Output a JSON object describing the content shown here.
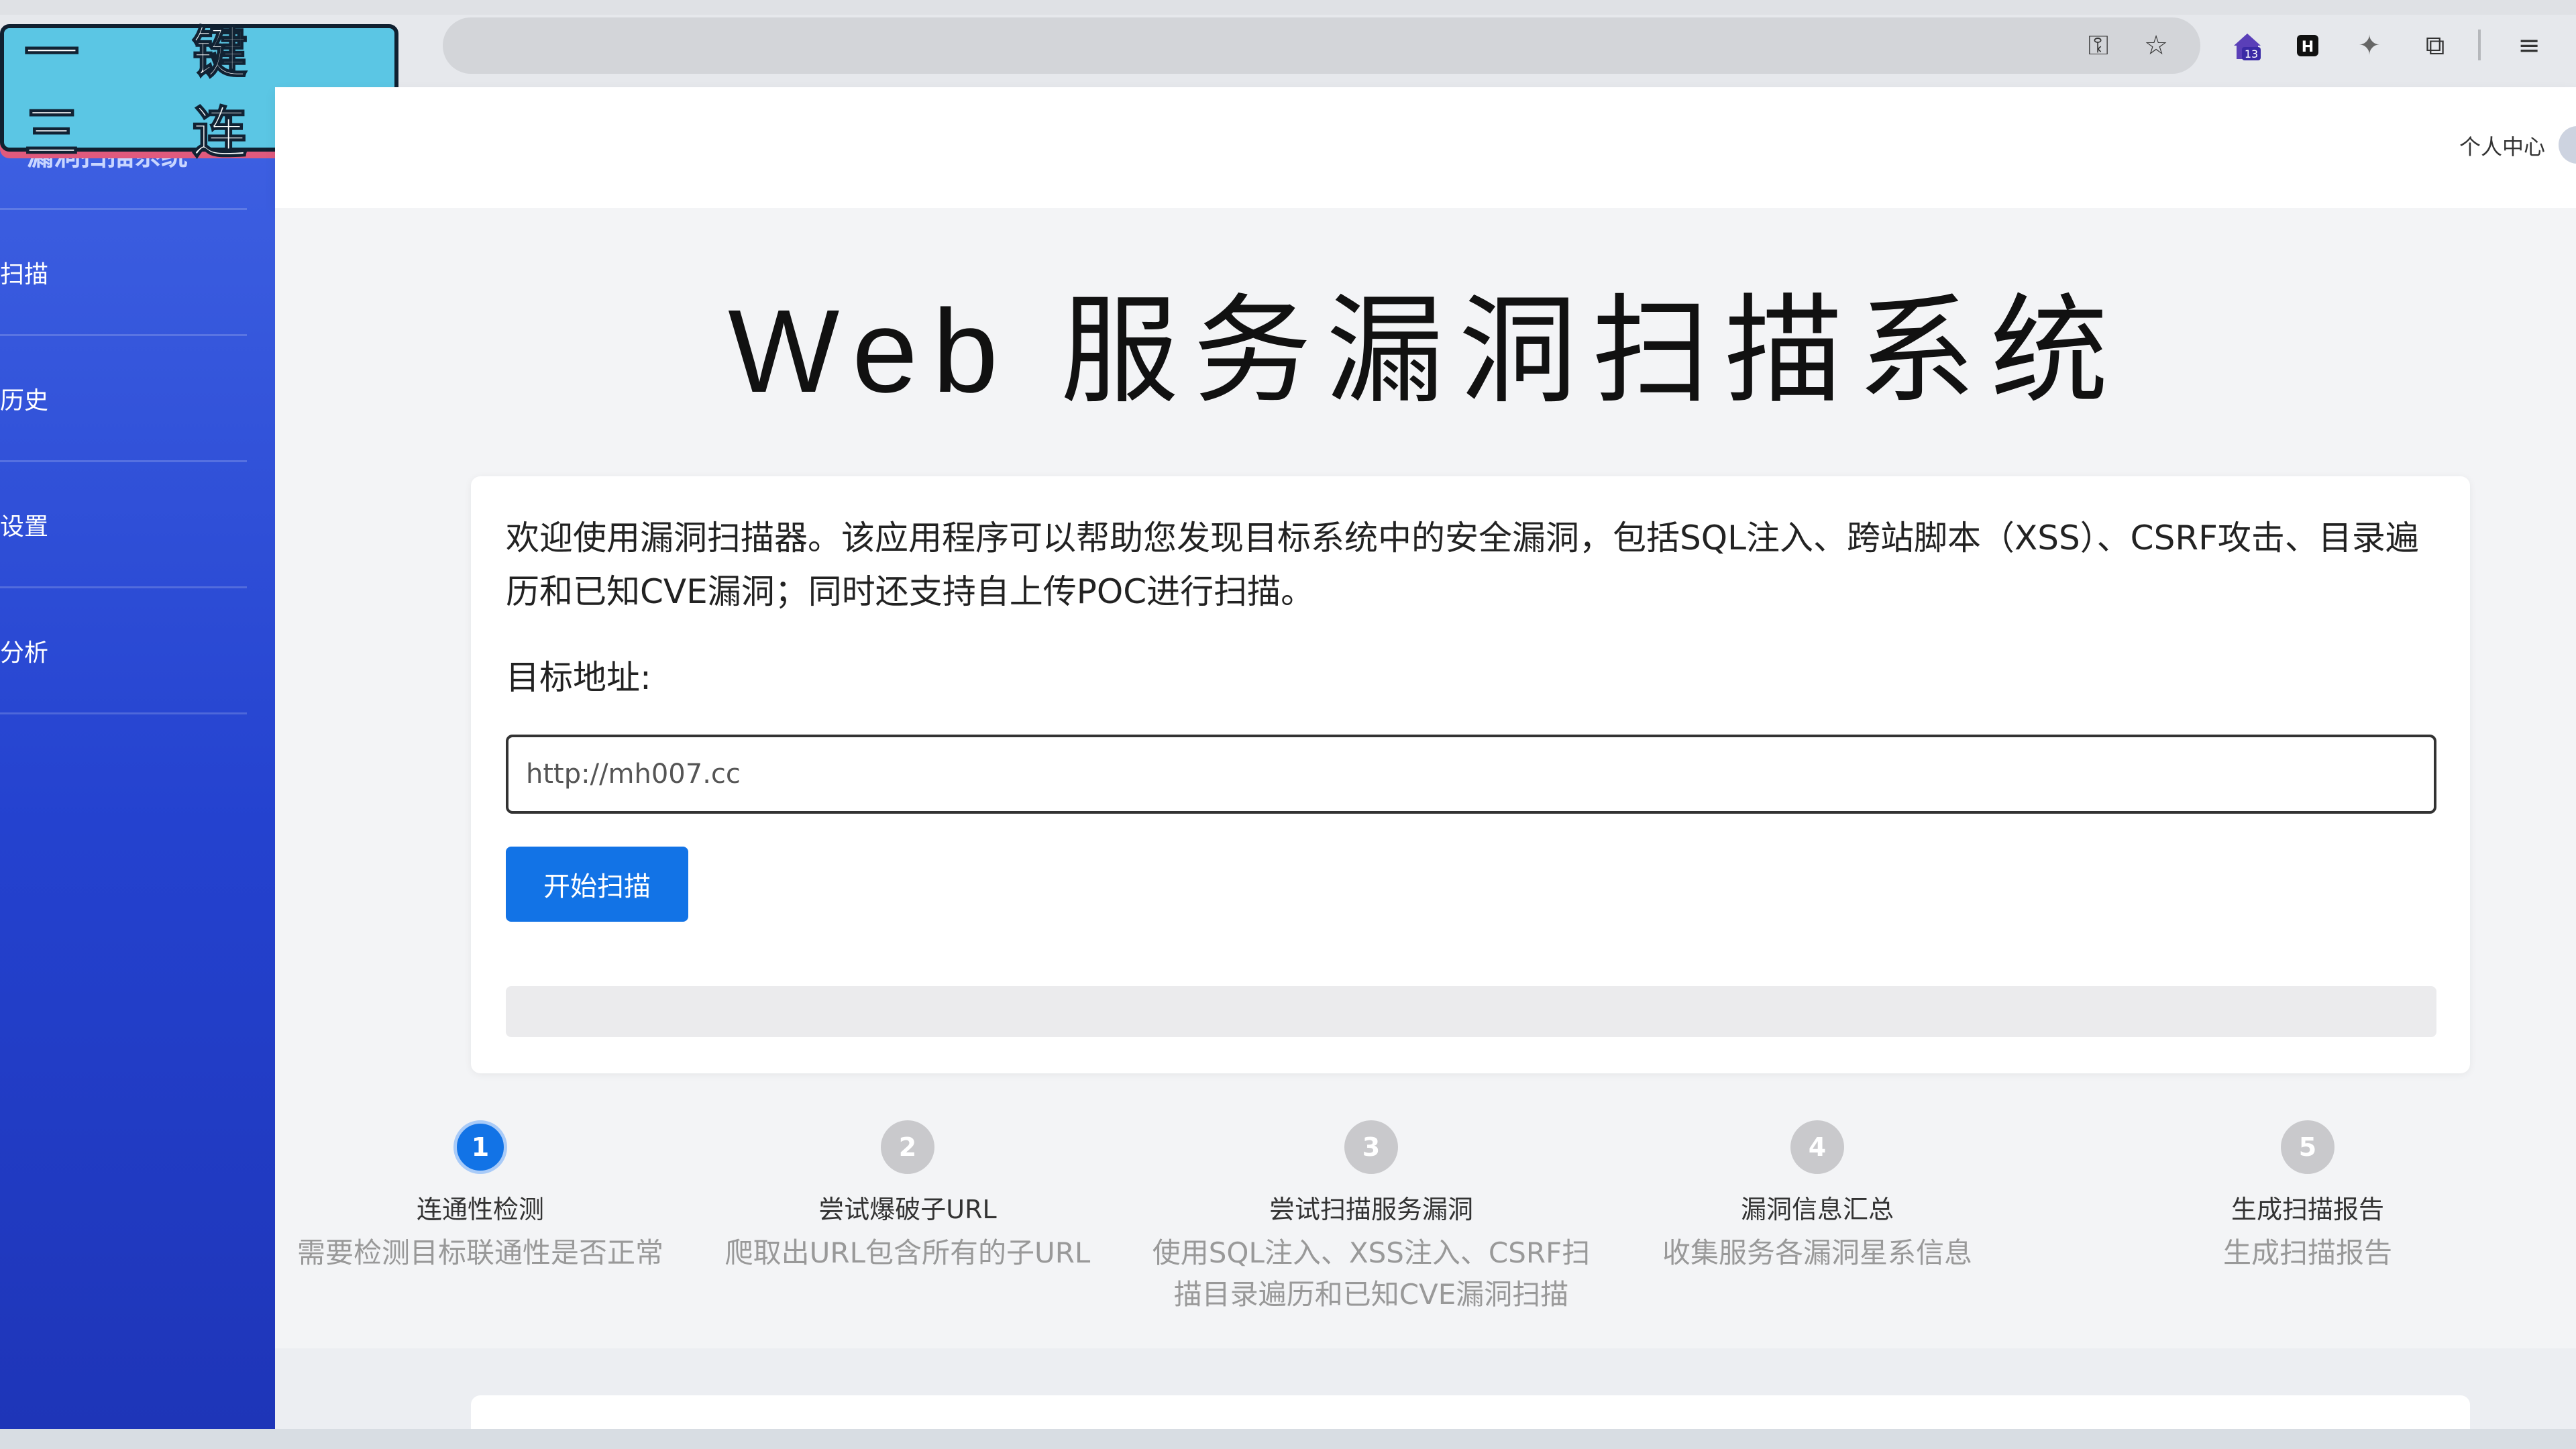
{
  "overlay": {
    "badge_text": "一 键 三 连",
    "star": "★"
  },
  "browser": {
    "icons": [
      "key-icon",
      "star-icon",
      "extension-badge-icon",
      "extension-icon",
      "puzzle-icon",
      "extensions-icon",
      "reading-list-icon"
    ],
    "extension_badge_count": "13"
  },
  "sidebar": {
    "brand": "漏洞扫描系统",
    "items": [
      {
        "label": "扫描"
      },
      {
        "label": "历史"
      },
      {
        "label": "设置"
      },
      {
        "label": "分析"
      }
    ]
  },
  "header": {
    "user_center": "个人中心"
  },
  "main": {
    "title": "Web 服务漏洞扫描系统",
    "description": "欢迎使用漏洞扫描器。该应用程序可以帮助您发现目标系统中的安全漏洞，包括SQL注入、跨站脚本（XSS）、CSRF攻击、目录遍历和已知CVE漏洞；同时还支持自上传POC进行扫描。",
    "target_label": "目标地址:",
    "target_value": "http://mh007.cc",
    "start_button": "开始扫描",
    "progress": 0
  },
  "steps": [
    {
      "num": "1",
      "name": "连通性检测",
      "desc": "需要检测目标联通性是否正常",
      "active": true
    },
    {
      "num": "2",
      "name": "尝试爆破子URL",
      "desc": "爬取出URL包含所有的子URL",
      "active": false
    },
    {
      "num": "3",
      "name": "尝试扫描服务漏洞",
      "desc": "使用SQL注入、XSS注入、CSRF扫描目录遍历和已知CVE漏洞扫描",
      "active": false
    },
    {
      "num": "4",
      "name": "漏洞信息汇总",
      "desc": "收集服务各漏洞星系信息",
      "active": false
    },
    {
      "num": "5",
      "name": "生成扫描报告",
      "desc": "生成扫描报告",
      "active": false
    }
  ]
}
